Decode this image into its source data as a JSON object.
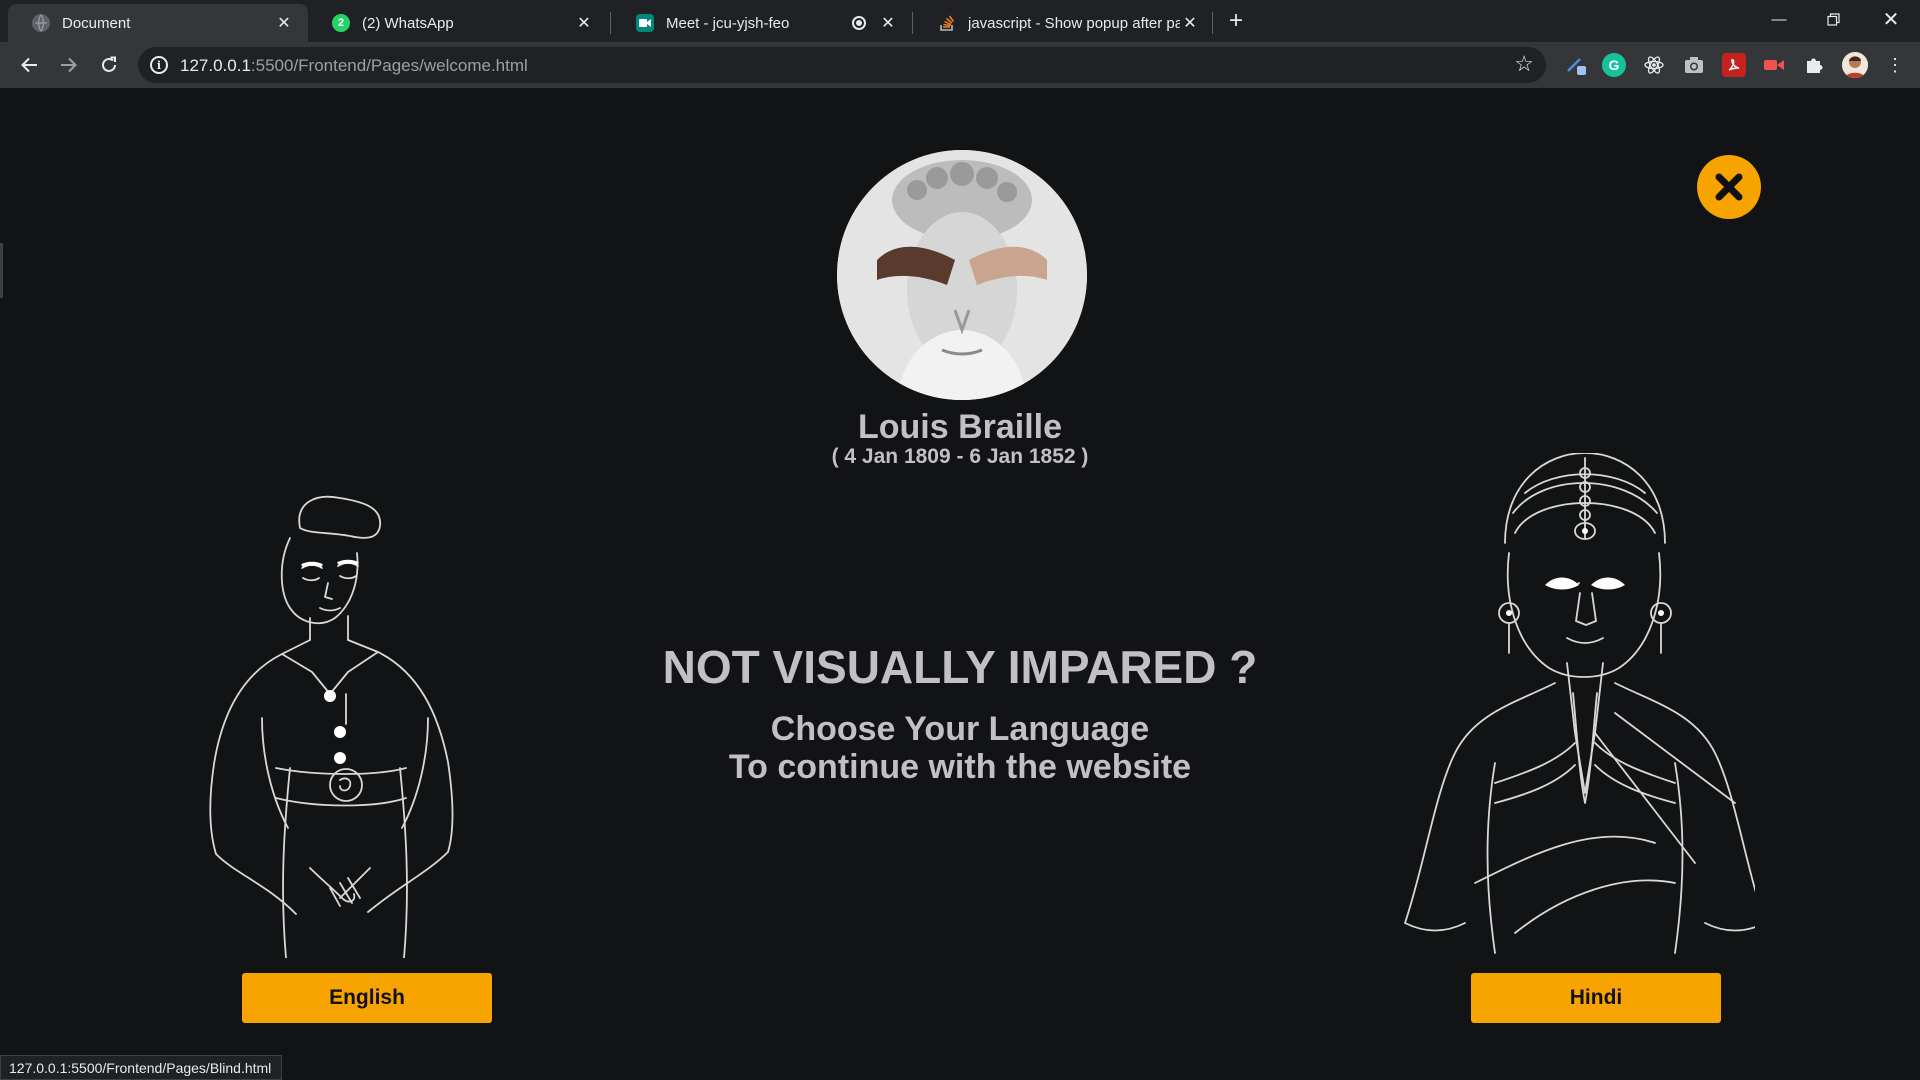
{
  "browser": {
    "tabs": [
      {
        "title": "Document",
        "active": true
      },
      {
        "title": "(2) WhatsApp",
        "badge": "2"
      },
      {
        "title": "Meet - jcu-yjsh-feo"
      },
      {
        "title": "javascript - Show popup after pa"
      }
    ],
    "url_host": "127.0.0.1",
    "url_path": ":5500/Frontend/Pages/welcome.html",
    "status_url": "127.0.0.1:5500/Frontend/Pages/Blind.html",
    "extensions": [
      "pen-icon",
      "grammarly-icon",
      "react-icon",
      "camera-icon",
      "pdf-icon",
      "video-icon",
      "puzzle-icon",
      "avatar"
    ]
  },
  "page": {
    "person_name": "Louis Braille",
    "person_dates": "( 4 Jan 1809 - 6 Jan 1852 )",
    "headline": "NOT VISUALLY IMPARED ?",
    "subline_1": "Choose Your Language",
    "subline_2": "To continue with the website",
    "english_label": "English",
    "hindi_label": "Hindi"
  },
  "colors": {
    "accent": "#f7a400",
    "background": "#111315",
    "text": "#c2bfc5"
  }
}
